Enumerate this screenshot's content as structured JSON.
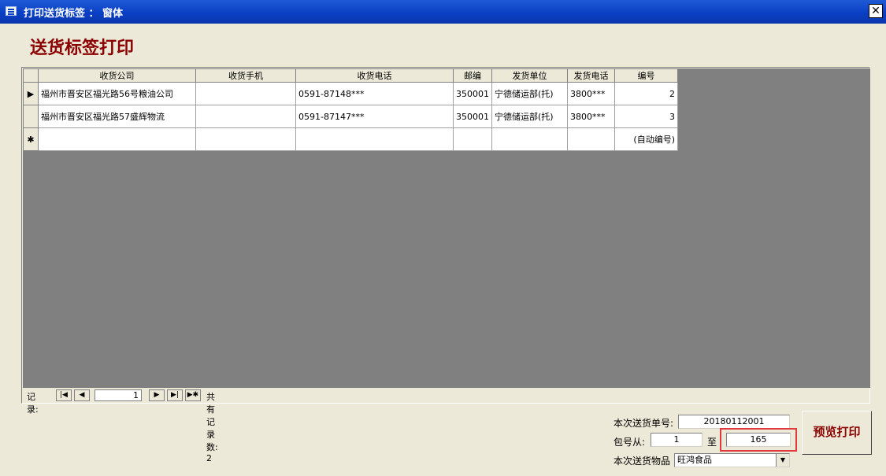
{
  "window": {
    "title": "打印送货标签 ： 窗体",
    "close_label": "✕"
  },
  "form": {
    "title": "送货标签打印"
  },
  "grid": {
    "columns": [
      "收货公司",
      "收货手机",
      "收货电话",
      "邮编",
      "发货单位",
      "发货电话",
      "编号"
    ],
    "rows": [
      [
        "福州市晋安区福光路56号粮油公司",
        "",
        "0591-87148***",
        "350001",
        "宁德储运部(托)",
        "3800***",
        "2"
      ],
      [
        "福州市晋安区福光路57盛辉物流",
        "",
        "0591-87147***",
        "350001",
        "宁德储运部(托)",
        "3800***",
        "3"
      ]
    ],
    "new_row": [
      "",
      "",
      "",
      "",
      "",
      "",
      "(自动编号)"
    ],
    "selector_current": "▶",
    "selector_new": "✱"
  },
  "nav": {
    "label": "记录:",
    "current": "1",
    "total_label": "共有记录数: 2",
    "first": "|◀",
    "prev": "◀",
    "next": "▶",
    "last": "▶|",
    "new": "▶✱"
  },
  "fields": {
    "delivery_no_label": "本次送货单号:",
    "delivery_no": "20180112001",
    "pkg_from_label": "包号从:",
    "pkg_from": "1",
    "to_label": "至",
    "pkg_to": "165",
    "goods_label": "本次送货物品",
    "goods": "旺鸿食品"
  },
  "buttons": {
    "preview_print": "预览打印"
  }
}
